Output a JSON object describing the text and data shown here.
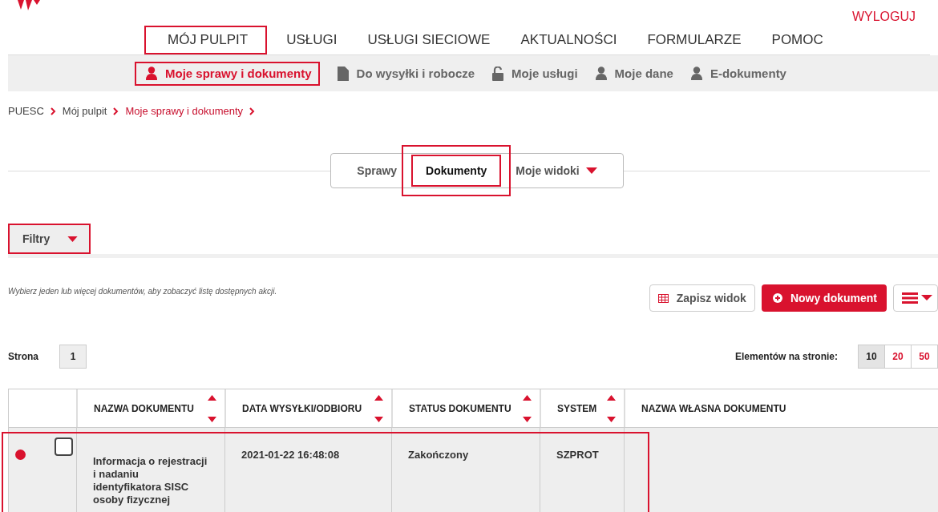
{
  "header": {
    "logout": "WYLOGUJ"
  },
  "main_nav": [
    {
      "label": "MÓJ PULPIT",
      "highlighted": true
    },
    {
      "label": "USŁUGI",
      "highlighted": false
    },
    {
      "label": "USŁUGI SIECIOWE",
      "highlighted": false
    },
    {
      "label": "AKTUALNOŚCI",
      "highlighted": false
    },
    {
      "label": "FORMULARZE",
      "highlighted": false
    },
    {
      "label": "POMOC",
      "highlighted": false
    }
  ],
  "sub_nav": [
    {
      "label": "Moje sprawy i dokumenty",
      "kind": "person",
      "selected": true,
      "highlighted": true
    },
    {
      "label": "Do wysyłki i robocze",
      "kind": "file",
      "selected": false,
      "highlighted": false
    },
    {
      "label": "Moje usługi",
      "kind": "unlock",
      "selected": false,
      "highlighted": false
    },
    {
      "label": "Moje dane",
      "kind": "person",
      "selected": false,
      "highlighted": false
    },
    {
      "label": "E-dokumenty",
      "kind": "person",
      "selected": false,
      "highlighted": false
    }
  ],
  "breadcrumb": [
    {
      "label": "PUESC",
      "current": false
    },
    {
      "label": "Mój pulpit",
      "current": false
    },
    {
      "label": "Moje sprawy i dokumenty",
      "current": true
    }
  ],
  "view_tabs": [
    {
      "label": "Sprawy",
      "selected": false,
      "highlighted": false,
      "dropdown": false
    },
    {
      "label": "Dokumenty",
      "selected": true,
      "highlighted": true,
      "dropdown": false
    },
    {
      "label": "Moje widoki",
      "selected": false,
      "highlighted": false,
      "dropdown": true
    }
  ],
  "filters": {
    "label": "Filtry",
    "highlighted": true
  },
  "hint": "Wybierz jeden lub więcej dokumentów, aby zobaczyć listę dostępnych akcji.",
  "actions": {
    "save_view": "Zapisz widok",
    "new_document": "Nowy dokument"
  },
  "pagination": {
    "label": "Strona",
    "pages": [
      {
        "label": "1"
      }
    ]
  },
  "page_size": {
    "label": "Elementów na stronie:",
    "options": [
      {
        "label": "10",
        "selected": true
      },
      {
        "label": "20",
        "selected": false
      },
      {
        "label": "50",
        "selected": false
      }
    ]
  },
  "table": {
    "columns": [
      {
        "label": "NAZWA DOKUMENTU",
        "sortable": true
      },
      {
        "label": "DATA WYSYŁKI/ODBIORU",
        "sortable": true
      },
      {
        "label": "STATUS DOKUMENTU",
        "sortable": true
      },
      {
        "label": "SYSTEM",
        "sortable": true
      },
      {
        "label": "NAZWA WŁASNA DOKUMENTU",
        "sortable": false
      }
    ],
    "rows": [
      {
        "unread": true,
        "checked": false,
        "highlighted": true,
        "cells": [
          "Informacja o rejestracji i nadaniu identyfikatora SISC osoby fizycznej",
          "2021-01-22 16:48:08",
          "Zakończony",
          "SZPROT",
          null
        ]
      }
    ]
  }
}
